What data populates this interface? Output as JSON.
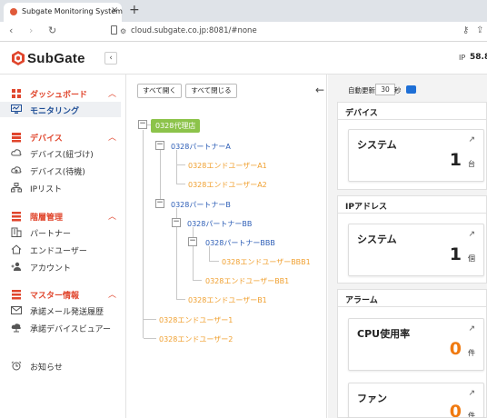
{
  "browser": {
    "tab_title": "Subgate Monitoring System",
    "tab_close": "×",
    "new_tab": "+",
    "url": "cloud.subgate.co.jp:8081/#none"
  },
  "header": {
    "logo_text": "SubGate",
    "collapse_label": "‹",
    "ip_label": "IP",
    "ip_value": "58.8"
  },
  "sidebar": {
    "sections": [
      {
        "label": "ダッシュボード",
        "items": [
          {
            "label": "モニタリング",
            "active": true
          }
        ]
      },
      {
        "label": "デバイス",
        "items": [
          {
            "label": "デバイス(紐づけ)"
          },
          {
            "label": "デバイス(待機)"
          },
          {
            "label": "IPリスト"
          }
        ]
      },
      {
        "label": "階層管理",
        "items": [
          {
            "label": "パートナー"
          },
          {
            "label": "エンドユーザー"
          },
          {
            "label": "アカウント"
          }
        ]
      },
      {
        "label": "マスター情報",
        "items": [
          {
            "label": "承諾メール発送履歴"
          },
          {
            "label": "承諾デバイスビュアー"
          }
        ]
      }
    ],
    "notice_label": "お知らせ"
  },
  "tree_toolbar": {
    "expand_all": "すべて開く",
    "collapse_all": "すべて閉じる",
    "back": "←"
  },
  "tree": {
    "root": "0328代理店",
    "partner_a": "0328パートナーA",
    "enduser_a1": "0328エンドユーザーA1",
    "enduser_a2": "0328エンドユーザーA2",
    "partner_b": "0328パートナーB",
    "partner_bb": "0328パートナーBB",
    "partner_bbb": "0328パートナーBBB",
    "enduser_bbb1": "0328エンドユーザーBBB1",
    "enduser_bb1": "0328エンドユーザーBB1",
    "enduser_b1": "0328エンドユーザーB1",
    "enduser_1": "0328エンドユーザー1",
    "enduser_2": "0328エンドユーザー2",
    "toggle_symbol": "−"
  },
  "dashboard": {
    "auto_refresh_label": "自動更新",
    "auto_refresh_value": "30",
    "auto_refresh_unit": "秒",
    "sections": {
      "device": {
        "title": "デバイス",
        "card_title": "システム",
        "value": "1",
        "unit": "台"
      },
      "ip": {
        "title": "IPアドレス",
        "card_title": "システム",
        "value": "1",
        "unit": "個"
      },
      "alarm": {
        "title": "アラーム",
        "cpu": {
          "title": "CPU使用率",
          "value": "0",
          "unit": "件"
        },
        "fan": {
          "title": "ファン",
          "value": "0",
          "unit": "件"
        }
      }
    },
    "external_link": "↗"
  },
  "colors": {
    "accent": "#e0462d",
    "active_text": "#1f4e96",
    "tree_blue": "#2c5db6",
    "tree_orange": "#f0a030",
    "root_green": "#8cc34a",
    "alert_value": "#f07a10"
  }
}
